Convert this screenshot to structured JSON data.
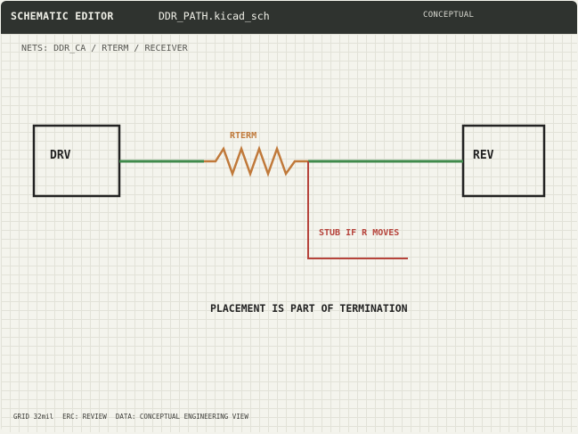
{
  "titlebar": {
    "app_name": "SCHEMATIC EDITOR",
    "file_name": "DDR_PATH.kicad_sch",
    "mode": "CONCEPTUAL"
  },
  "nets_label": "NETS: DDR_CA / RTERM / RECEIVER",
  "schematic": {
    "driver_label": "DRV",
    "receiver_label": "REV",
    "resistor_label": "RTERM",
    "stub_label": "STUB IF R MOVES",
    "caption": "PLACEMENT IS PART OF TERMINATION"
  },
  "status_bar": {
    "grid": "GRID 32mil",
    "erc": "ERC: REVIEW",
    "data": "DATA: CONCEPTUAL ENGINEERING VIEW"
  },
  "colors": {
    "titlebar_bg": "#2f332f",
    "net_green": "#3f8a4b",
    "resistor_orange": "#c0793a",
    "stub_red": "#b6433b",
    "component_outline": "#222222"
  }
}
